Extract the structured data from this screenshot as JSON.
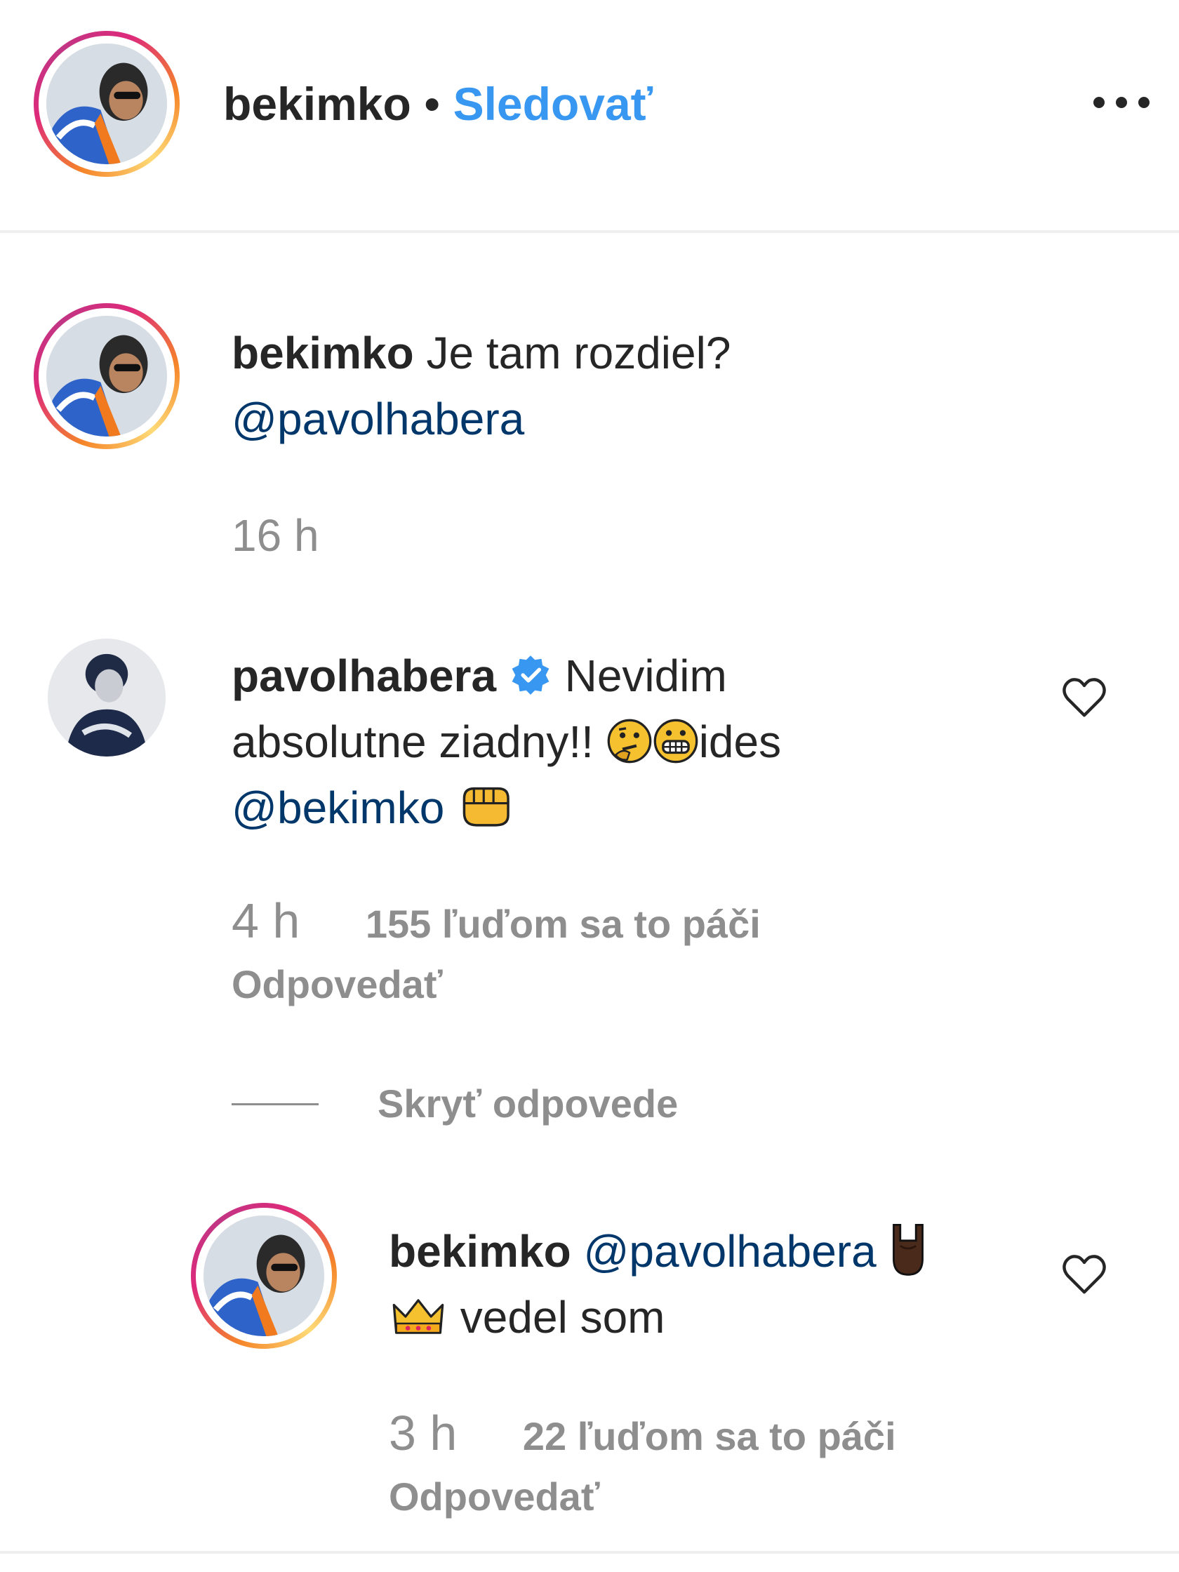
{
  "header": {
    "username": "bekimko",
    "separator": "•",
    "follow_label": "Sledovať",
    "more_icon": "more-horizontal-icon"
  },
  "caption": {
    "username": "bekimko",
    "text": "Je tam rozdiel?",
    "mention": "@pavolhabera",
    "time": "16 h"
  },
  "comment": {
    "username": "pavolhabera",
    "verified_icon": "verified-badge-icon",
    "text_line1": "Nevidim",
    "text_line2": "absolutne ziadny!!",
    "text_after_emoji": "ides",
    "mention": "@bekimko",
    "emojis": [
      "thinking-face-emoji",
      "grinning-face-emoji",
      "fist-emoji"
    ],
    "time": "4 h",
    "likes": "155 ľuďom sa to páči",
    "reply_label": "Odpovedať",
    "hide_replies_label": "Skryť odpovede"
  },
  "reply": {
    "username": "bekimko",
    "mention": "@pavolhabera",
    "text": "vedel som",
    "emojis": [
      "sign-of-horns-emoji",
      "crown-emoji"
    ],
    "time": "3 h",
    "likes": "22 ľuďom sa to páči",
    "reply_label": "Odpovedať"
  },
  "colors": {
    "link_blue": "#3897f0",
    "mention": "#00376b",
    "meta_gray": "#8e8e8e",
    "verified": "#3897f0"
  }
}
